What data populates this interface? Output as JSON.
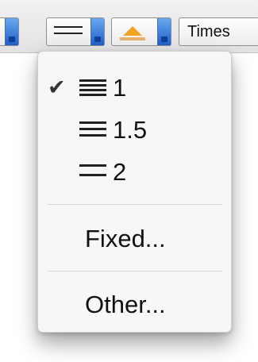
{
  "toolbar": {
    "font_popup_value": "Times"
  },
  "menu": {
    "items": [
      {
        "label": "1",
        "checked": true,
        "icon": "line-spacing-single-icon"
      },
      {
        "label": "1.5",
        "checked": false,
        "icon": "line-spacing-one-half-icon"
      },
      {
        "label": "2",
        "checked": false,
        "icon": "line-spacing-double-icon"
      }
    ],
    "check_glyph": "✔",
    "fixed_label": "Fixed...",
    "other_label": "Other..."
  }
}
